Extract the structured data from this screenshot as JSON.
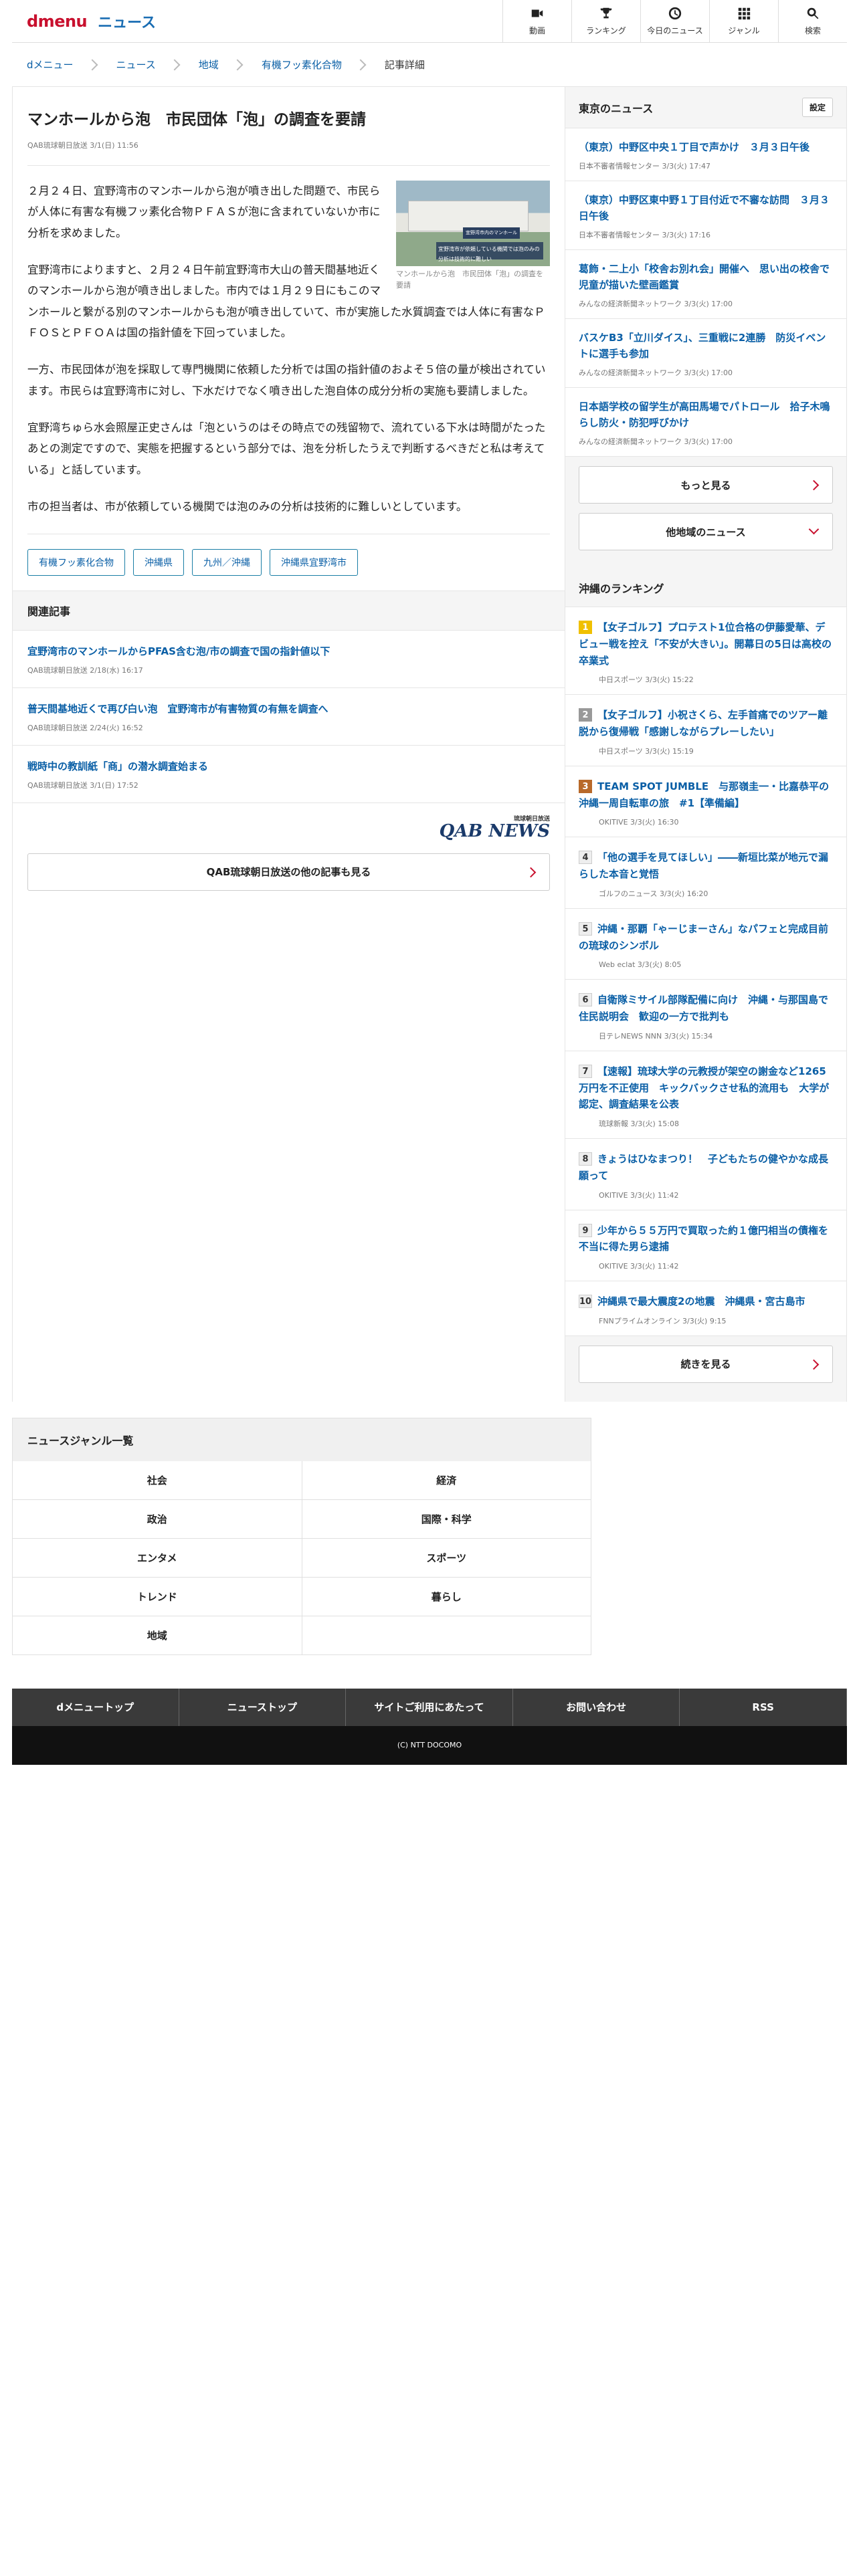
{
  "header": {
    "logo_text": "dmenu",
    "section": "ニュース",
    "nav": [
      {
        "label": "動画",
        "icon": "video-icon"
      },
      {
        "label": "ランキング",
        "icon": "trophy-icon"
      },
      {
        "label": "今日のニュース",
        "icon": "clock-icon"
      },
      {
        "label": "ジャンル",
        "icon": "grid-icon"
      },
      {
        "label": "検索",
        "icon": "search-icon"
      }
    ]
  },
  "breadcrumb": [
    "dメニュー",
    "ニュース",
    "地域",
    "有機フッ素化合物",
    "記事詳細"
  ],
  "article": {
    "title": "マンホールから泡　市民団体「泡」の調査を要請",
    "meta": "QAB琉球朝日放送 3/1(日) 11:56",
    "image_caption": "マンホールから泡　市民団体「泡」の調査を要請",
    "image_overlay": "宜野湾市が依頼している機関では泡のみの分析は技術的に難しい",
    "image_tag": "宜野湾市内のマンホール",
    "paragraphs": [
      "２月２４日、宜野湾市のマンホールから泡が噴き出した問題で、市民らが人体に有害な有機フッ素化合物ＰＦＡＳが泡に含まれていないか市に分析を求めました。",
      "宜野湾市によりますと、２月２４日午前宜野湾市大山の普天間基地近くのマンホールから泡が噴き出しました。市内では１月２９日にもこのマンホールと繋がる別のマンホールからも泡が噴き出していて、市が実施した水質調査では人体に有害なＰＦＯＳとＰＦＯＡは国の指針値を下回っていました。",
      "一方、市民団体が泡を採取して専門機関に依頼した分析では国の指針値のおよそ５倍の量が検出されています。市民らは宜野湾市に対し、下水だけでなく噴き出した泡自体の成分分析の実施も要請しました。",
      "宜野湾ちゅら水会照屋正史さんは「泡というのはその時点での残留物で、流れている下水は時間がたったあとの測定ですので、実態を把握するという部分では、泡を分析したうえで判断するべきだと私は考えている」と話しています。",
      "市の担当者は、市が依頼している機関では泡のみの分析は技術的に難しいとしています。"
    ],
    "tags": [
      "有機フッ素化合物",
      "沖縄県",
      "九州／沖縄",
      "沖縄県宜野湾市"
    ]
  },
  "related": {
    "heading": "関連記事",
    "items": [
      {
        "title": "宜野湾市のマンホールからPFAS含む泡/市の調査で国の指針値以下",
        "meta": "QAB琉球朝日放送 2/18(水) 16:17"
      },
      {
        "title": "普天間基地近くで再び白い泡　宜野湾市が有害物質の有無を調査へ",
        "meta": "QAB琉球朝日放送 2/24(火) 16:52"
      },
      {
        "title": "戦時中の教訓紙「商」の潜水調査始まる",
        "meta": "QAB琉球朝日放送 3/1(日) 17:52"
      }
    ]
  },
  "brand": {
    "name": "QAB NEWS",
    "sub": "琉球朝日放送"
  },
  "more_from_source": "QAB琉球朝日放送の他の記事も見る",
  "side_news": {
    "heading": "東京のニュース",
    "settings": "設定",
    "items": [
      {
        "title": "（東京）中野区中央１丁目で声かけ　３月３日午後",
        "meta": "日本不審者情報センター 3/3(火) 17:47"
      },
      {
        "title": "（東京）中野区東中野１丁目付近で不審な訪問　３月３日午後",
        "meta": "日本不審者情報センター 3/3(火) 17:16"
      },
      {
        "title": "葛飾・二上小「校舎お別れ会」開催へ　思い出の校舎で児童が描いた壁画鑑賞",
        "meta": "みんなの経済新聞ネットワーク 3/3(火) 17:00"
      },
      {
        "title": "バスケB3「立川ダイス」、三重戦に2連勝　防災イベントに選手も参加",
        "meta": "みんなの経済新聞ネットワーク 3/3(火) 17:00"
      },
      {
        "title": "日本語学校の留学生が高田馬場でパトロール　拾子木鳴らし防火・防犯呼びかけ",
        "meta": "みんなの経済新聞ネットワーク 3/3(火) 17:00"
      }
    ],
    "more": "もっと見る",
    "other_region": "他地域のニュース"
  },
  "ranking": {
    "heading": "沖縄のランキング",
    "items": [
      {
        "num": "1",
        "title": "【女子ゴルフ】プロテスト1位合格の伊藤愛華、デビュー戦を控え「不安が大きい」。開幕日の5日は高校の卒業式",
        "meta": "中日スポーツ 3/3(火) 15:22"
      },
      {
        "num": "2",
        "title": "【女子ゴルフ】小祝さくら、左手首痛でのツアー離脱から復帰戦「感謝しながらプレーしたい」",
        "meta": "中日スポーツ 3/3(火) 15:19"
      },
      {
        "num": "3",
        "title": "TEAM SPOT JUMBLE　与那嶺圭一・比嘉恭平の 沖縄一周自転車の旅　#1【準備編】",
        "meta": "OKITIVE 3/3(火) 16:30"
      },
      {
        "num": "4",
        "title": "「他の選手を見てほしい」――新垣比菜が地元で漏らした本音と覚悟",
        "meta": "ゴルフのニュース 3/3(火) 16:20"
      },
      {
        "num": "5",
        "title": "沖縄・那覇「ゃーじまーさん」なパフェと完成目前の琉球のシンボル",
        "meta": "Web eclat 3/3(火) 8:05"
      },
      {
        "num": "6",
        "title": "自衛隊ミサイル部隊配備に向け　沖縄・与那国島で住民説明会　歓迎の一方で批判も",
        "meta": "日テレNEWS NNN 3/3(火) 15:34"
      },
      {
        "num": "7",
        "title": "【速報】琉球大学の元教授が架空の謝金など1265万円を不正使用　キックバックさせ私的流用も　大学が認定、調査結果を公表",
        "meta": "琉球新報 3/3(火) 15:08"
      },
      {
        "num": "8",
        "title": "きょうはひなまつり！　子どもたちの健やかな成長願って",
        "meta": "OKITIVE 3/3(火) 11:42"
      },
      {
        "num": "9",
        "title": "少年から５５万円で買取った約１億円相当の債権を不当に得た男ら逮捕",
        "meta": "OKITIVE 3/3(火) 11:42"
      },
      {
        "num": "10",
        "title": "沖縄県で最大震度2の地震　沖縄県・宮古島市",
        "meta": "FNNプライムオンライン 3/3(火) 9:15"
      }
    ],
    "more": "続きを見る"
  },
  "genres": {
    "heading": "ニュースジャンル一覧",
    "items": [
      "社会",
      "経済",
      "政治",
      "国際・科学",
      "エンタメ",
      "スポーツ",
      "トレンド",
      "暮らし",
      "地域",
      ""
    ]
  },
  "footer": {
    "links": [
      "dメニュートップ",
      "ニューストップ",
      "サイトご利用にあたって",
      "お問い合わせ",
      "RSS"
    ],
    "copyright": "(C) NTT DOCOMO"
  }
}
